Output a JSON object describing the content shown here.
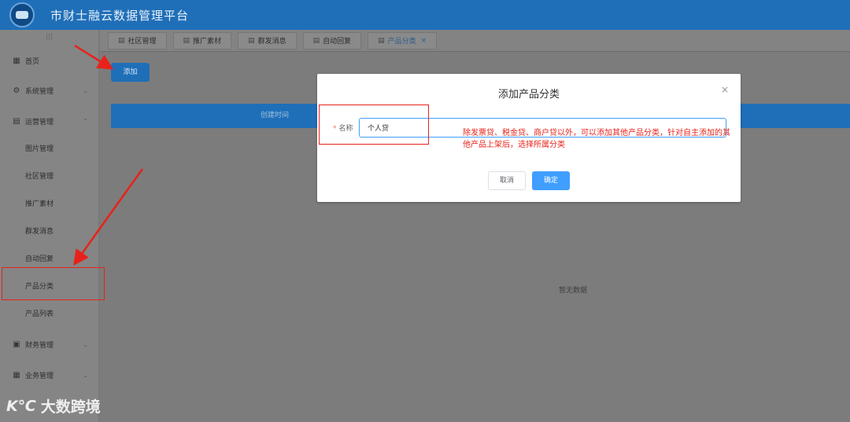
{
  "header": {
    "title": "市财士融云数据管理平台",
    "logo_icon": "platform-logo-icon"
  },
  "sidebar": {
    "collapse_handle": "|||",
    "items": [
      {
        "label": "首页",
        "icon": "grid-icon",
        "glyph": "▦"
      },
      {
        "label": "系统管理",
        "icon": "gear-icon",
        "glyph": "⚙",
        "chevron": "⌄"
      },
      {
        "label": "运营管理",
        "icon": "document-icon",
        "glyph": "▤",
        "chevron": "⌃"
      },
      {
        "label": "财务管理",
        "icon": "finance-icon",
        "glyph": "▣",
        "chevron": "⌄"
      },
      {
        "label": "业务管理",
        "icon": "apps-icon",
        "glyph": "▦",
        "chevron": "⌄"
      }
    ],
    "sub_items": [
      "图片管理",
      "社区管理",
      "推广素材",
      "群发消息",
      "自动回复",
      "产品分类",
      "产品列表"
    ]
  },
  "tabs": [
    {
      "label": "社区管理",
      "icon": "document-icon",
      "glyph": "▤"
    },
    {
      "label": "推广素材",
      "icon": "document-icon",
      "glyph": "▤"
    },
    {
      "label": "群发消息",
      "icon": "document-icon",
      "glyph": "▤"
    },
    {
      "label": "自动回复",
      "icon": "document-icon",
      "glyph": "▤"
    },
    {
      "label": "产品分类",
      "icon": "document-icon",
      "glyph": "▤",
      "close": "×"
    }
  ],
  "main": {
    "add_button": "添加",
    "table_header": "创建时间",
    "empty_text": "暂无数据"
  },
  "dialog": {
    "title": "添加产品分类",
    "close_glyph": "×",
    "required_mark": "*",
    "name_label": "名称",
    "name_value": "个人贷",
    "cancel": "取消",
    "confirm": "确定"
  },
  "annotation": {
    "text": "除发票贷、税金贷、商户贷以外，可以添加其他产品分类，针对自主添加的其他产品上架后，选择所属分类",
    "color": "#e8221a"
  },
  "watermark": {
    "logo_text": "K℃",
    "text": "大数跨境"
  },
  "colors": {
    "header": "#1f6fb8",
    "primary": "#409eff",
    "overlay": "#7a7a7a"
  }
}
